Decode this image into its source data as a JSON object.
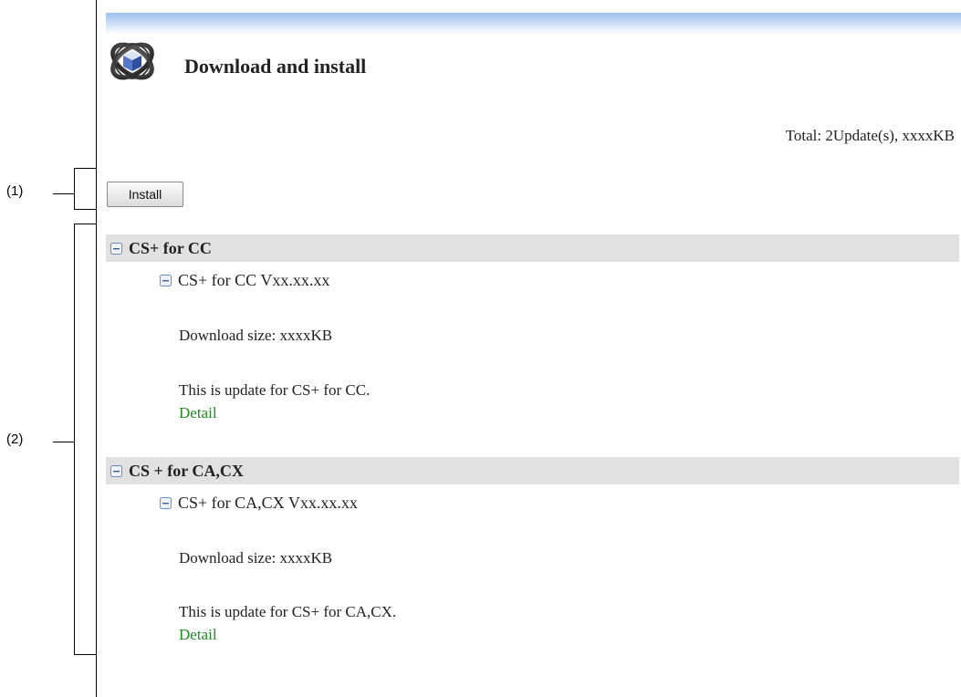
{
  "annotations": {
    "label_1": "(1)",
    "label_2": "(2)"
  },
  "header": {
    "title": "Download and install",
    "icon": "globe-cube-icon"
  },
  "summary": {
    "total": "Total: 2Update(s), xxxxKB"
  },
  "toolbar": {
    "install_label": "Install"
  },
  "groups": [
    {
      "name": "CS+ for CC",
      "item": {
        "name": "CS+ for CC Vxx.xx.xx",
        "download_size": "Download size: xxxxKB",
        "description": "This is update for CS+ for CC.",
        "detail_label": "Detail"
      }
    },
    {
      "name": "CS + for CA,CX",
      "item": {
        "name": "CS+ for CA,CX Vxx.xx.xx",
        "download_size": "Download size: xxxxKB",
        "description": "This is update for CS+ for CA,CX.",
        "detail_label": "Detail"
      }
    }
  ],
  "colors": {
    "header_band": "#9fc0ee",
    "group_bg": "#e1e1e1",
    "link": "#1f8a1f",
    "collapse_icon": "#6f8fc2"
  }
}
